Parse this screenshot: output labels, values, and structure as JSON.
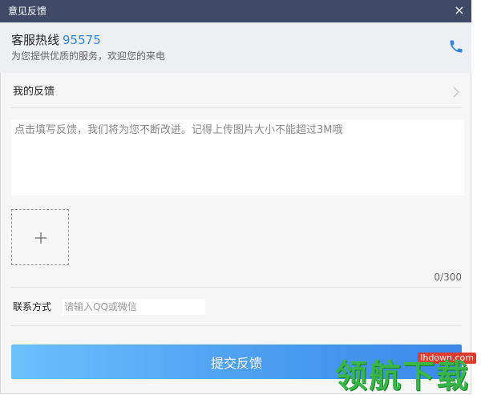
{
  "window": {
    "title": "意见反馈",
    "close_label": "×"
  },
  "hotline": {
    "label": "客服热线",
    "number": "95575",
    "subtitle": "为您提供优质的服务，欢迎您的来电",
    "icon": "phone-icon"
  },
  "feedback": {
    "my_feedback_label": "我的反馈",
    "chevron_icon": "chevron-right-icon",
    "placeholder": "点击填写反馈，我们将为您不断改进。记得上传图片大小不能超过3M哦",
    "value": "",
    "upload_icon": "plus-icon",
    "counter": "0/300"
  },
  "contact": {
    "label": "联系方式",
    "placeholder": "请输入QQ或微信",
    "value": ""
  },
  "submit": {
    "label": "提交反馈"
  },
  "watermark": {
    "site": "lhdown.com",
    "text": "领航下载"
  },
  "colors": {
    "titlebar": "#3f4a66",
    "accent": "#2e86de",
    "button_start": "#6cc0fb",
    "button_end": "#3b88ea",
    "watermark_green": "#39b54a",
    "watermark_red": "#e33a2b"
  }
}
